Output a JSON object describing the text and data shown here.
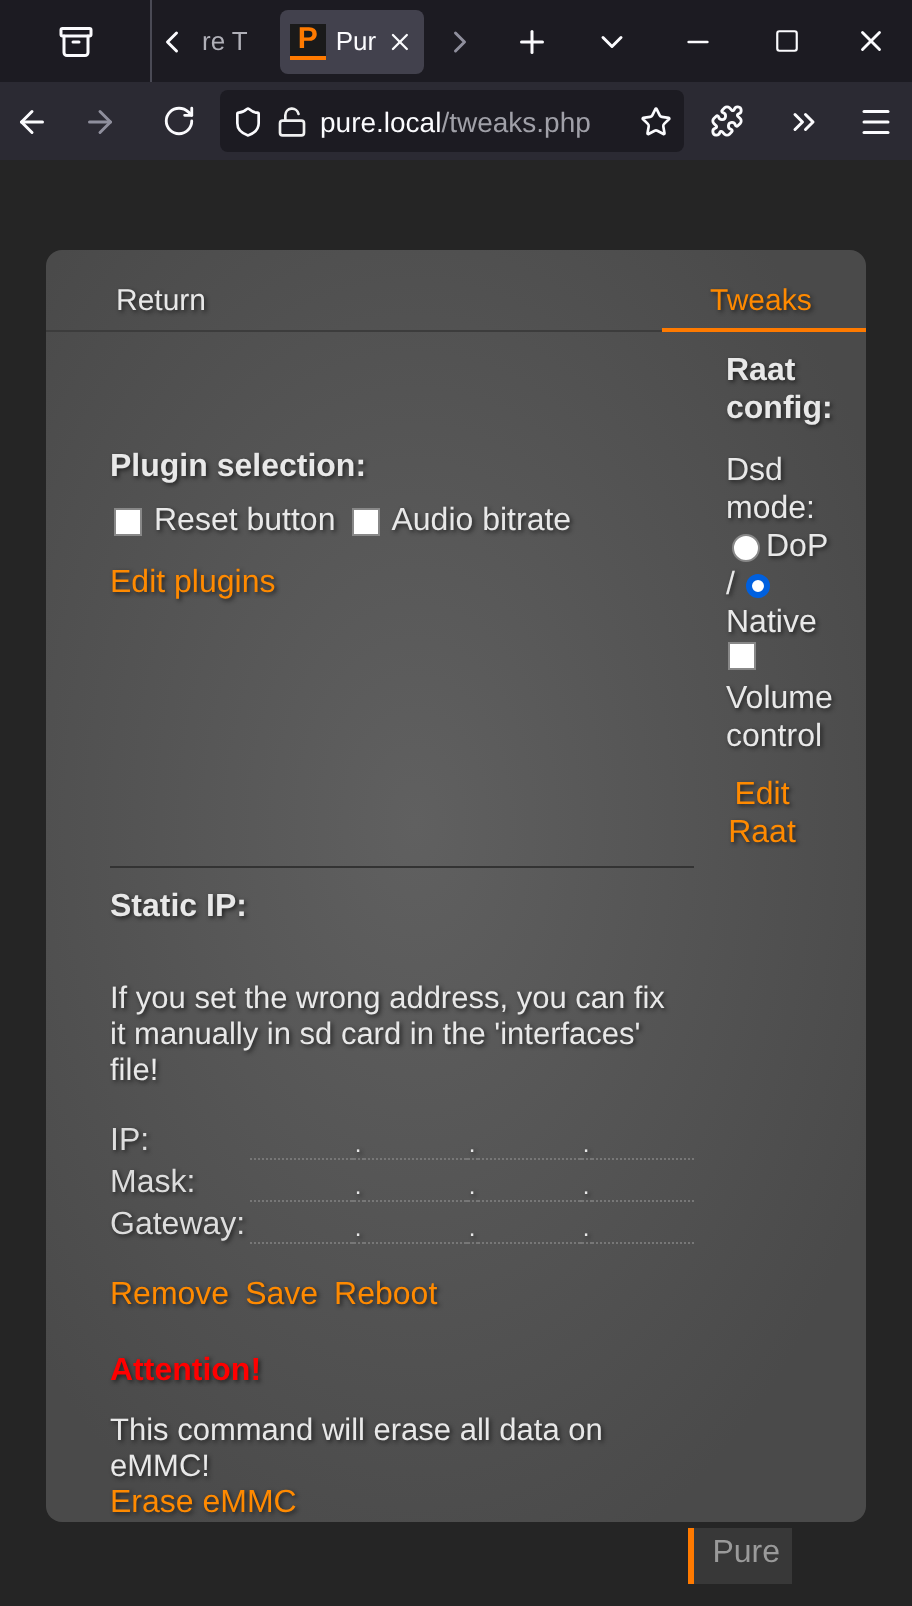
{
  "browser": {
    "tabs": [
      {
        "title": "re T",
        "selected": false
      },
      {
        "title": "Pur",
        "favicon": "P",
        "selected": true
      }
    ],
    "url_host": "pure.local",
    "url_path": "/tweaks.php"
  },
  "nav": [
    {
      "label": "Return",
      "selected": false
    },
    {
      "label": "Tweaks",
      "selected": true
    }
  ],
  "plugins": {
    "heading": "Plugin selection:",
    "options": [
      {
        "label": "Reset button",
        "checked": false
      },
      {
        "label": "Audio bitrate",
        "checked": false
      }
    ],
    "link": "Edit plugins"
  },
  "raat": {
    "heading": "Raat config:",
    "dsd_label": "Dsd mode:",
    "separator": "/",
    "radios": [
      {
        "label": "DoP",
        "selected": false
      },
      {
        "label": "Native",
        "selected": true
      }
    ],
    "volume": {
      "label": "Volume control",
      "checked": false
    },
    "link": "Edit Raat"
  },
  "static_ip": {
    "heading": "Static IP:",
    "note": "If you set the wrong address, you can fix it manually in sd card in the 'interfaces' file!",
    "fields": [
      {
        "label": "IP:",
        "separator": "."
      },
      {
        "label": "Mask:",
        "separator": "."
      },
      {
        "label": "Gateway:",
        "separator": "."
      }
    ],
    "actions": [
      "Remove",
      "Save",
      "Reboot"
    ]
  },
  "emmc": {
    "warning": "Attention!",
    "note": "This command will erase all data on eMMC!",
    "link": "Erase eMMC"
  },
  "footer_tag": "Pure"
}
